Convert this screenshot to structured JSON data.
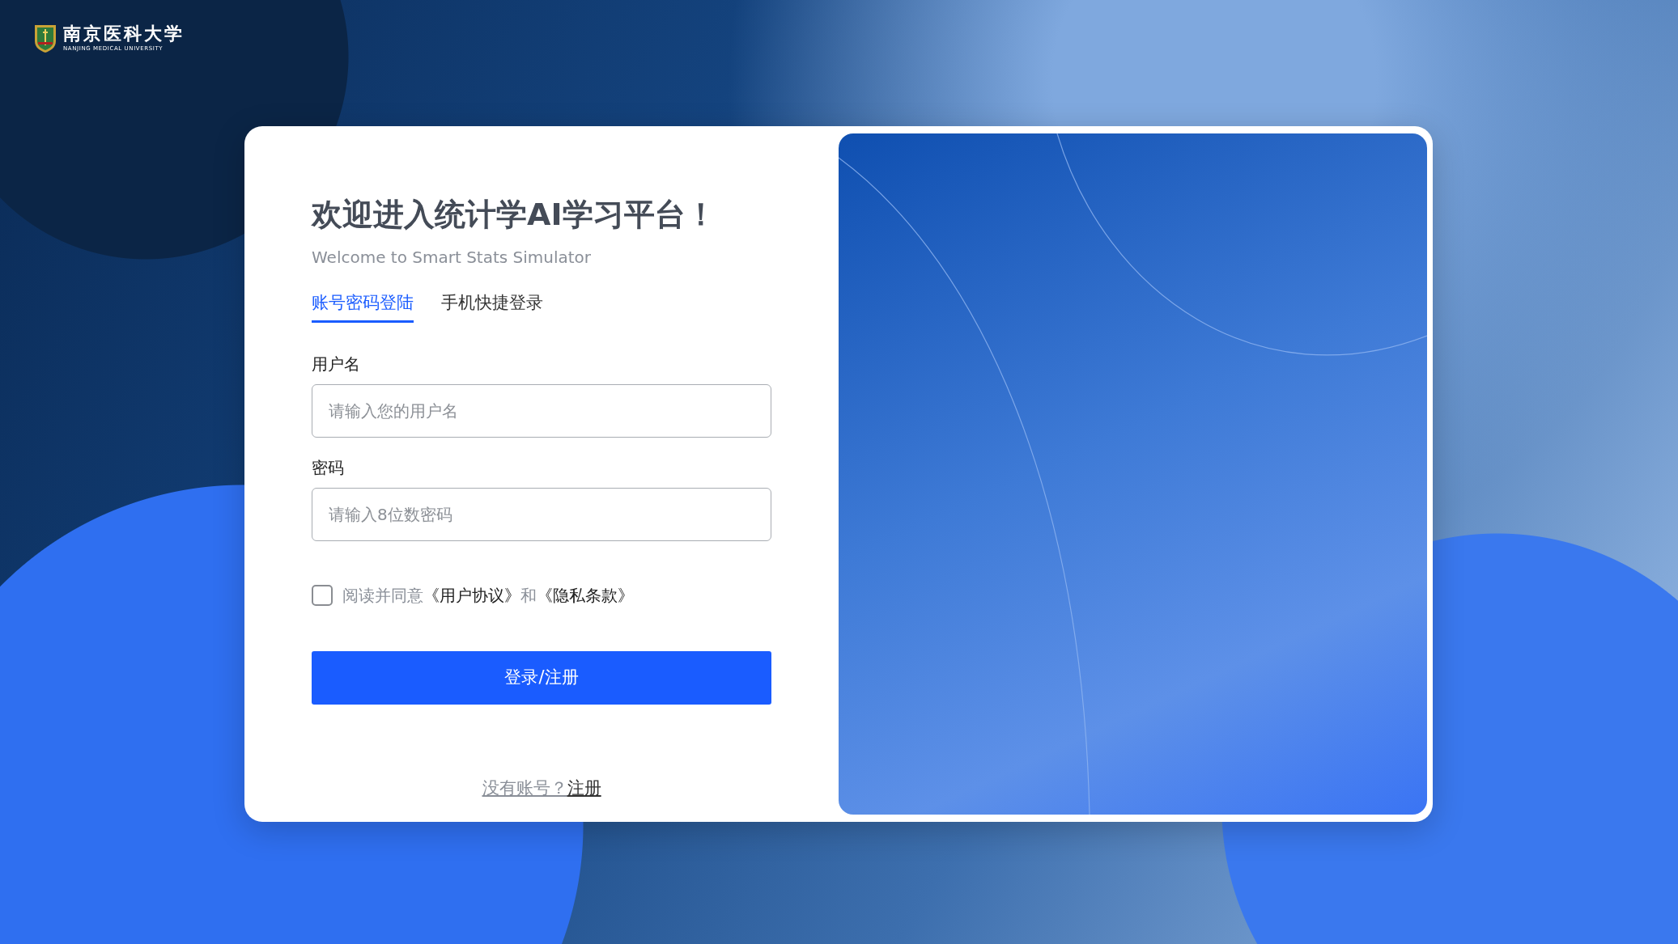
{
  "logo": {
    "name_zh": "南京医科大学",
    "name_en": "NANJING MEDICAL UNIVERSITY"
  },
  "title": "欢迎进入统计学AI学习平台！",
  "subtitle": "Welcome to Smart Stats Simulator",
  "tabs": [
    {
      "label": "账号密码登陆",
      "selected": true
    },
    {
      "label": "手机快捷登录",
      "selected": false
    }
  ],
  "fields": [
    {
      "label": "用户名",
      "placeholder": "请输入您的用户名"
    },
    {
      "label": "密码",
      "placeholder": "请输入8位数密码"
    }
  ],
  "agreement": {
    "checked": false,
    "parts": [
      {
        "kind": "text",
        "text": "阅读并同意"
      },
      {
        "kind": "link",
        "text": "《用户协议》"
      },
      {
        "kind": "text",
        "text": "和"
      },
      {
        "kind": "link",
        "text": "《隐私条款》"
      }
    ]
  },
  "submit": "登录/注册",
  "signup": {
    "prompt": "没有账号？",
    "link": "注册"
  }
}
